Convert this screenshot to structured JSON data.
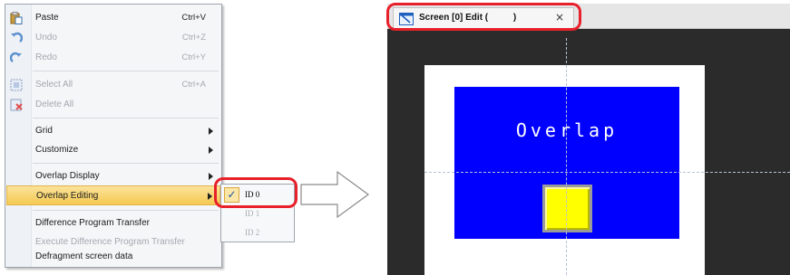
{
  "context_menu": {
    "paste": {
      "label": "Paste",
      "shortcut": "Ctrl+V"
    },
    "undo": {
      "label": "Undo",
      "shortcut": "Ctrl+Z"
    },
    "redo": {
      "label": "Redo",
      "shortcut": "Ctrl+Y"
    },
    "select_all": {
      "label": "Select All",
      "shortcut": "Ctrl+A"
    },
    "delete_all": {
      "label": "Delete All"
    },
    "grid": {
      "label": "Grid"
    },
    "customize": {
      "label": "Customize"
    },
    "overlap_display": {
      "label": "Overlap Display"
    },
    "overlap_editing": {
      "label": "Overlap Editing"
    },
    "difference_program_transfer": {
      "label": "Difference Program Transfer"
    },
    "execute_difference_program_transfer": {
      "label": "Execute Difference Program Transfer"
    },
    "defragment_screen_data": {
      "label": "Defragment screen data"
    }
  },
  "submenu": {
    "items": [
      {
        "label": "ID 0",
        "checked": true
      },
      {
        "label": "ID 1"
      },
      {
        "label": "ID 2"
      }
    ],
    "check_mark": "✓"
  },
  "editor": {
    "tab_title": "Screen [0] Edit (          )",
    "tab_close": "×",
    "overlap_text": "Overlap"
  },
  "colors": {
    "highlight_box": "#e8202a",
    "canvas_blue": "#0000ff",
    "button_yellow": "#ffff00",
    "editor_bg": "#2b2b2b"
  },
  "icons": [
    "paste-icon",
    "undo-icon",
    "redo-icon",
    "select-all-icon",
    "delete-all-icon",
    "screen-edit-icon",
    "right-arrow-icon"
  ]
}
